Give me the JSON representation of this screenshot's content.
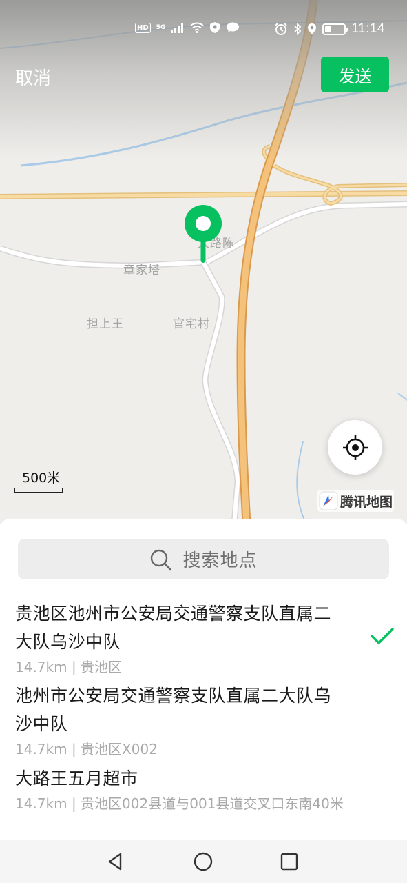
{
  "status_bar": {
    "hd": "HD",
    "network": "5G",
    "time": "11:14",
    "battery_level": 0.35
  },
  "header": {
    "cancel_label": "取消",
    "send_label": "发送"
  },
  "map": {
    "labels": {
      "lu": "大路陈",
      "zhang": "章家塔",
      "dan": "担上王",
      "guan": "官宅村"
    },
    "scale": "500米",
    "provider": "腾讯地图"
  },
  "search": {
    "placeholder": "搜索地点"
  },
  "results": [
    {
      "name": "贵池区池州市公安局交通警察支队直属二大队乌沙中队",
      "sub": "14.7km | 贵池区",
      "selected": true
    },
    {
      "name": "池州市公安局交通警察支队直属二大队乌沙中队",
      "sub": "14.7km | 贵池区X002",
      "selected": false
    },
    {
      "name": "大路王五月超市",
      "sub": "14.7km | 贵池区002县道与001县道交叉口东南40米",
      "selected": false
    }
  ],
  "colors": {
    "accent": "#07c160",
    "highway": "#f4c27a",
    "expressway": "#f7dba3",
    "water": "#a9cbe8"
  },
  "icons": {
    "status": [
      "signal-icon",
      "wifi-icon",
      "vpn-icon",
      "message-icon",
      "alarm-icon",
      "bluetooth-icon",
      "location-icon",
      "battery-icon"
    ],
    "map": [
      "location-pin-icon",
      "locate-icon",
      "tencent-map-logo"
    ],
    "nav": [
      "back-icon",
      "home-icon",
      "recent-apps-icon"
    ]
  }
}
